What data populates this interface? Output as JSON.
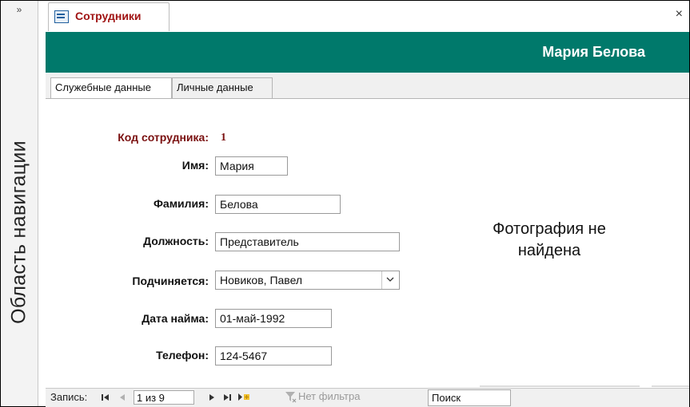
{
  "nav_pane": {
    "toggle": "»",
    "label": "Область навигации"
  },
  "document_tab": {
    "title": "Сотрудники",
    "close": "×"
  },
  "header": {
    "title": "Мария Белова"
  },
  "tabs": [
    {
      "label": "Служебные данные",
      "active": true
    },
    {
      "label": "Личные данные",
      "active": false
    }
  ],
  "form": {
    "id_label": "Код сотрудника:",
    "id_value": "1",
    "fields": {
      "first_name": {
        "label": "Имя:",
        "value": "Мария"
      },
      "last_name": {
        "label": "Фамилия:",
        "value": "Белова"
      },
      "position": {
        "label": "Должность:",
        "value": "Представитель"
      },
      "reports_to": {
        "label": "Подчиняется:",
        "value": "Новиков, Павел"
      },
      "hire_date": {
        "label": "Дата найма:",
        "value": "01-май-1992"
      },
      "phone": {
        "label": "Телефон:",
        "value": "124-5467"
      }
    },
    "photo_placeholder": {
      "line1": "Фотография не",
      "line2": "найдена"
    }
  },
  "record_nav": {
    "label": "Запись:",
    "current": "1 из 9",
    "filter": "Нет фильтра",
    "search": "Поиск"
  },
  "colors": {
    "header_bg": "#00796b",
    "tab_title": "#a01414",
    "id_text": "#7a1010"
  },
  "icons": [
    "form-icon",
    "close-icon",
    "first-record-icon",
    "prev-record-icon",
    "next-record-icon",
    "last-record-icon",
    "new-record-icon",
    "filter-icon",
    "dropdown-chevron-icon"
  ]
}
